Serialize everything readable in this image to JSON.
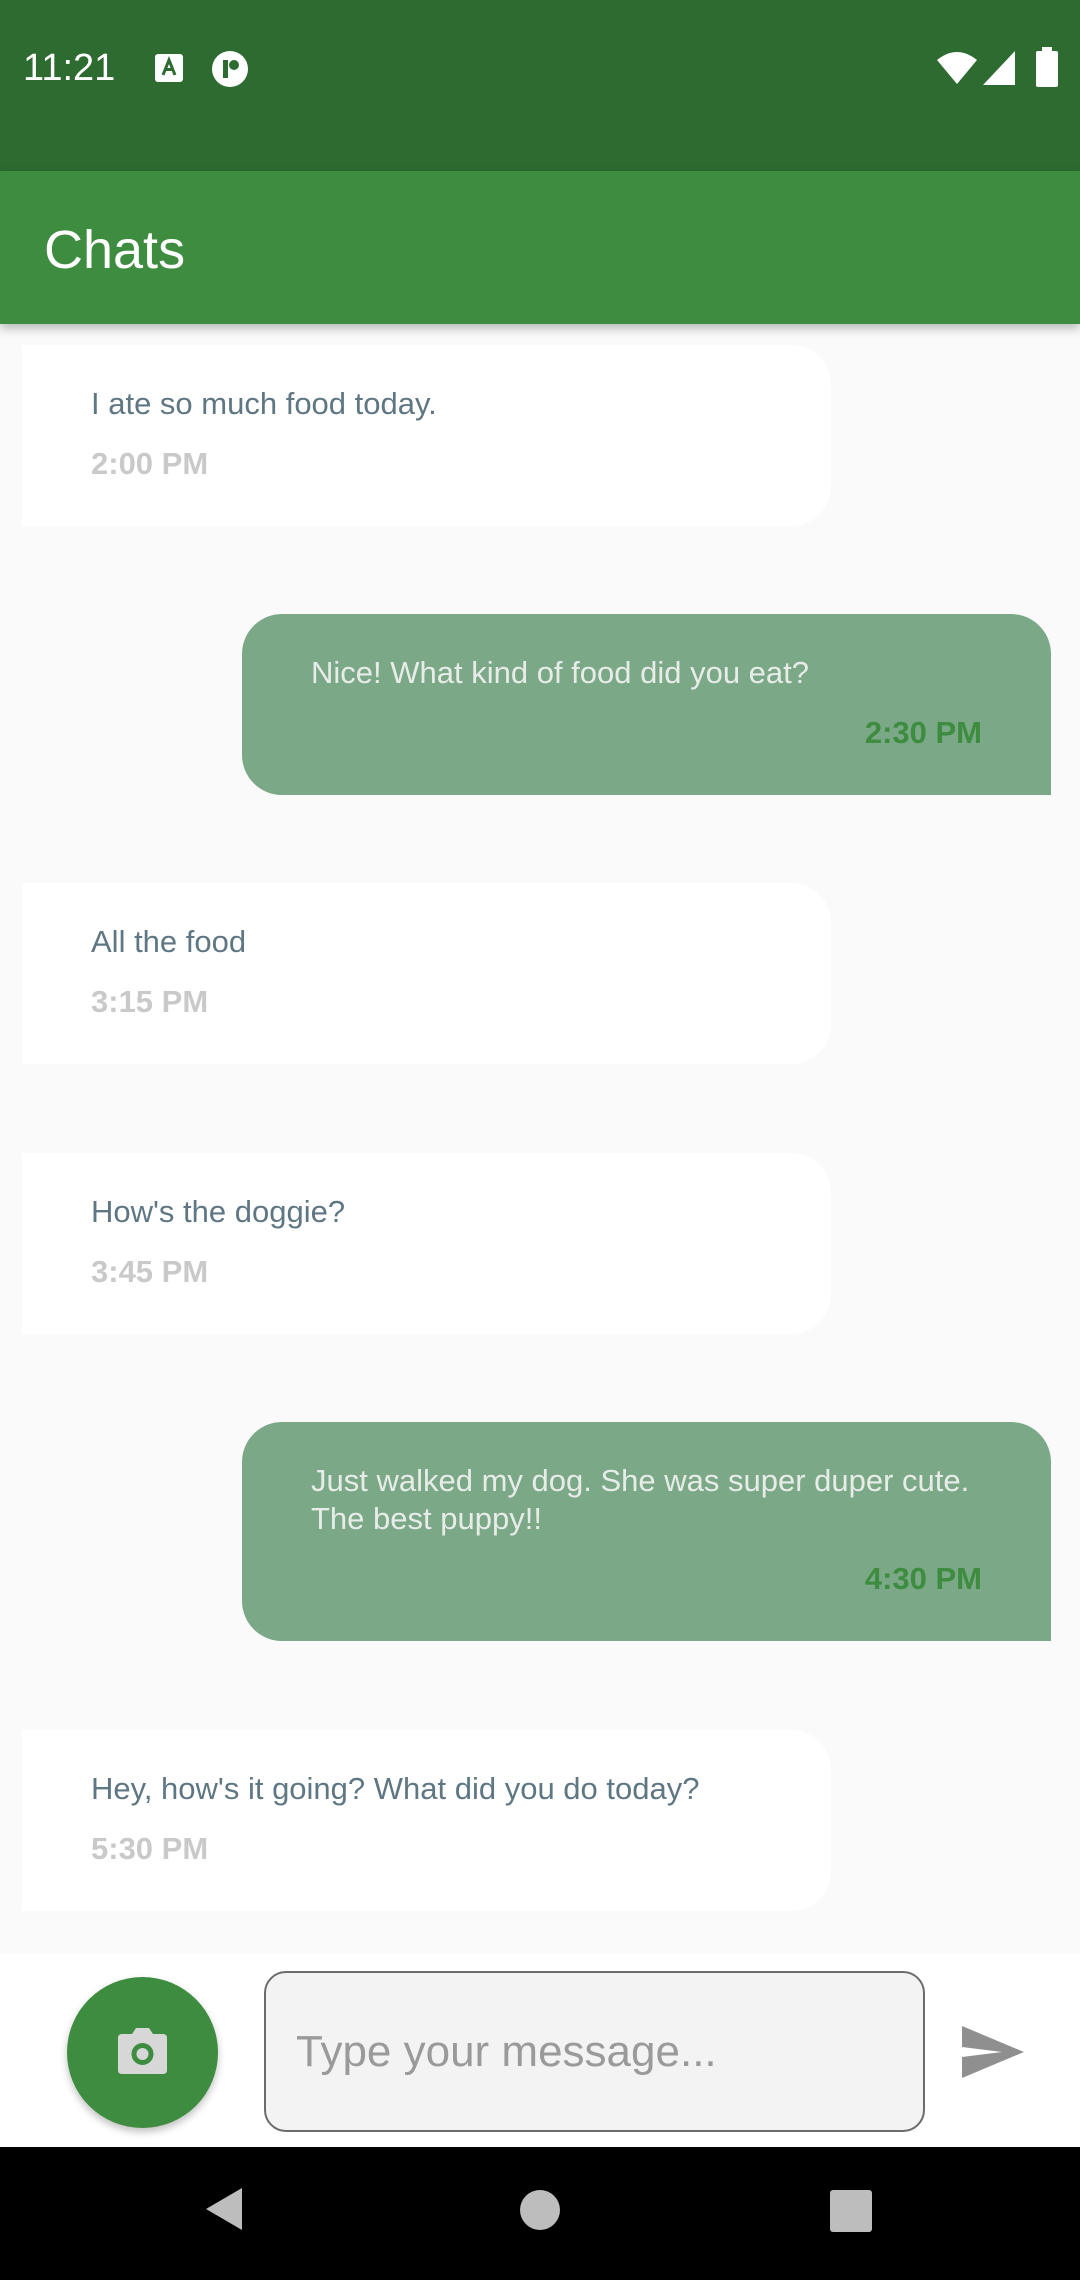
{
  "status_bar": {
    "time": "11:21",
    "icons": [
      "a11y-icon",
      "record-icon",
      "wifi-icon",
      "cellular-signal-icon",
      "battery-icon"
    ]
  },
  "app_bar": {
    "title": "Chats"
  },
  "messages": [
    {
      "direction": "incoming",
      "text": "I ate so much food today.",
      "time": "2:00 PM"
    },
    {
      "direction": "outgoing",
      "text": "Nice! What kind of food did you eat?",
      "time": "2:30 PM"
    },
    {
      "direction": "incoming",
      "text": "All the food",
      "time": "3:15 PM"
    },
    {
      "direction": "incoming",
      "text": "How's the doggie?",
      "time": "3:45 PM"
    },
    {
      "direction": "outgoing",
      "text": "Just walked my dog. She was super duper cute. The best puppy!!",
      "time": "4:30 PM"
    },
    {
      "direction": "incoming",
      "text": "Hey, how's it going? What did you do today?",
      "time": "5:30 PM"
    }
  ],
  "composer": {
    "placeholder": "Type your message...",
    "value": "",
    "camera_icon": "camera-icon",
    "send_icon": "send-icon"
  },
  "nav_bar": {
    "icons": [
      "back-icon",
      "home-icon",
      "recents-icon"
    ]
  },
  "colors": {
    "status_bar": "#2e6b31",
    "app_bar": "#3d8c40",
    "outgoing_bubble": "#7ba886",
    "incoming_bubble": "#ffffff",
    "accent_time": "#3d8c40"
  }
}
